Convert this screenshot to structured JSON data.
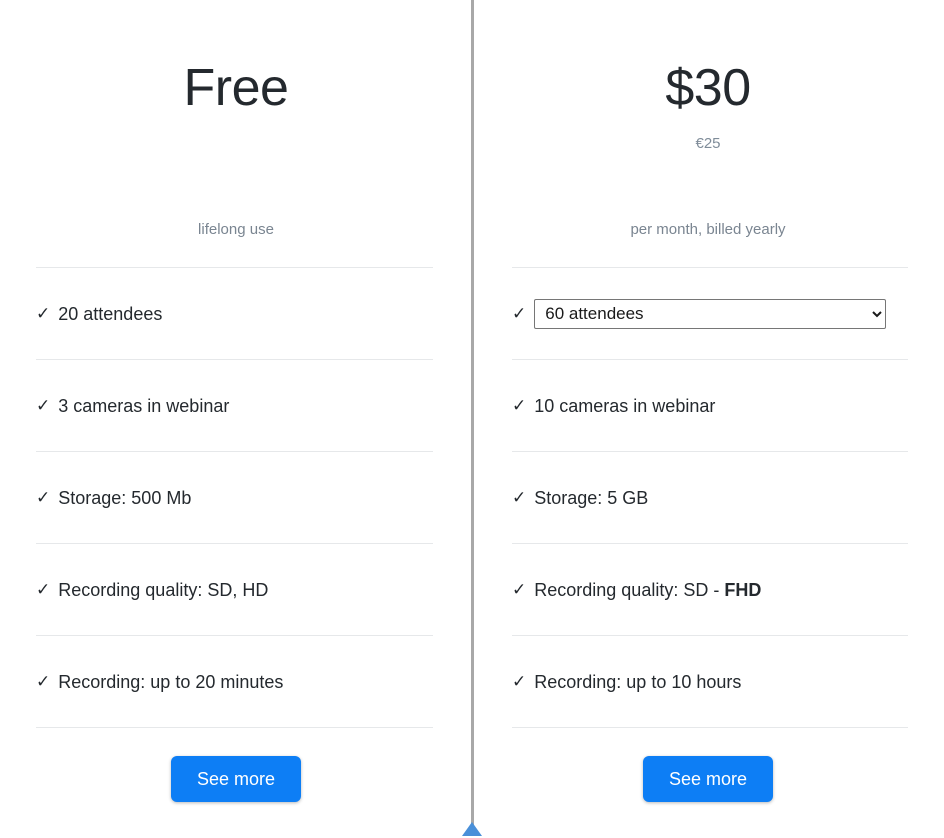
{
  "theme": {
    "accent": "#0d7ef5",
    "heading_color": "#24292e",
    "muted_color": "#7a8591",
    "rule_color": "#e6e8ea",
    "divider_color": "#a8a8a8",
    "handle_color": "#4a90d9"
  },
  "plans": [
    {
      "id": "free",
      "price": "Free",
      "price_alt": "",
      "note": "lifelong use",
      "check_glyph": "✓",
      "features": [
        {
          "type": "text",
          "label": "20 attendees"
        },
        {
          "type": "text",
          "label": "3 cameras in webinar"
        },
        {
          "type": "text",
          "label": "Storage: 500 Mb"
        },
        {
          "type": "text",
          "label": "Recording quality: SD, HD"
        },
        {
          "type": "text",
          "label": "Recording: up to 20 minutes"
        }
      ],
      "cta_label": "See more"
    },
    {
      "id": "paid",
      "price": "$30",
      "price_alt": "€25",
      "note": "per month, billed yearly",
      "check_glyph": "✓",
      "features": [
        {
          "type": "select",
          "name": "attendees",
          "value": "60 attendees",
          "options": [
            "60 attendees"
          ]
        },
        {
          "type": "text",
          "label": "10 cameras in webinar"
        },
        {
          "type": "text",
          "label": "Storage: 5 GB"
        },
        {
          "type": "text",
          "label": "Recording quality: SD - ",
          "emphasis": "FHD"
        },
        {
          "type": "text",
          "label": "Recording: up to 10 hours"
        }
      ],
      "cta_label": "See more"
    }
  ]
}
